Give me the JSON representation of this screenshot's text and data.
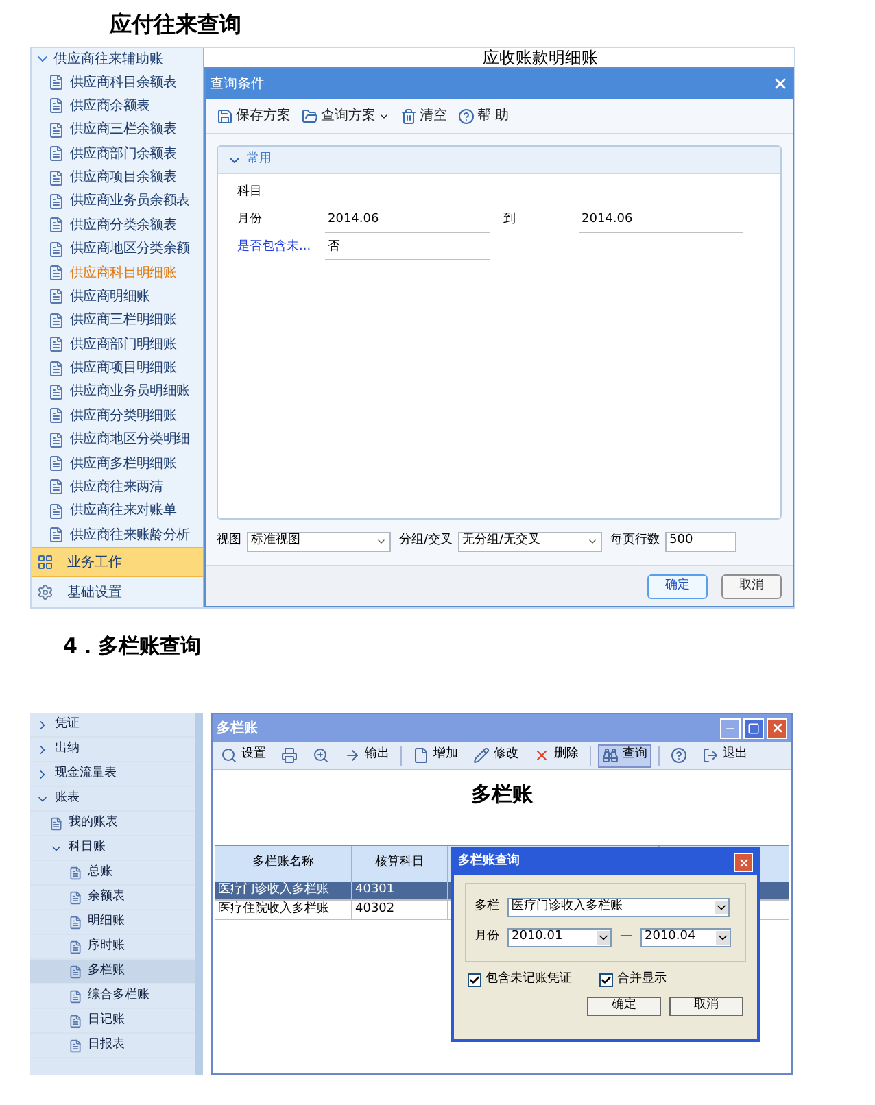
{
  "section1": {
    "heading": "应付往来查询",
    "sidebar": {
      "group": {
        "label": "供应商往来辅助账",
        "expanded": true
      },
      "items": [
        {
          "label": "供应商科目余额表",
          "selected": false
        },
        {
          "label": "供应商余额表",
          "selected": false
        },
        {
          "label": "供应商三栏余额表",
          "selected": false
        },
        {
          "label": "供应商部门余额表",
          "selected": false
        },
        {
          "label": "供应商项目余额表",
          "selected": false
        },
        {
          "label": "供应商业务员余额表",
          "selected": false
        },
        {
          "label": "供应商分类余额表",
          "selected": false
        },
        {
          "label": "供应商地区分类余额",
          "selected": false
        },
        {
          "label": "供应商科目明细账",
          "selected": true
        },
        {
          "label": "供应商明细账",
          "selected": false
        },
        {
          "label": "供应商三栏明细账",
          "selected": false
        },
        {
          "label": "供应商部门明细账",
          "selected": false
        },
        {
          "label": "供应商项目明细账",
          "selected": false
        },
        {
          "label": "供应商业务员明细账",
          "selected": false
        },
        {
          "label": "供应商分类明细账",
          "selected": false
        },
        {
          "label": "供应商地区分类明细",
          "selected": false
        },
        {
          "label": "供应商多栏明细账",
          "selected": false
        },
        {
          "label": "供应商往来两清",
          "selected": false
        },
        {
          "label": "供应商往来对账单",
          "selected": false
        },
        {
          "label": "供应商往来账龄分析",
          "selected": false
        }
      ],
      "nav": [
        {
          "label": "业务工作",
          "selected": true,
          "kind": "work"
        },
        {
          "label": "基础设置",
          "selected": false,
          "kind": "settings"
        }
      ]
    },
    "background_title": "应收账款明细账",
    "dialog": {
      "title": "查询条件",
      "toolbar": [
        {
          "label": "保存方案",
          "kind": "save",
          "dropdown": false
        },
        {
          "label": "查询方案",
          "kind": "folder",
          "dropdown": true
        },
        {
          "label": "清空",
          "kind": "clear",
          "dropdown": false
        },
        {
          "label": "帮 助",
          "kind": "help",
          "dropdown": false
        }
      ],
      "group": {
        "label": "常用",
        "expanded": true
      },
      "fields": [
        {
          "label": "科目",
          "link": false
        },
        {
          "label": "月份",
          "value": "2014.06",
          "link": false,
          "to_label": "到",
          "to_value": "2014.06"
        },
        {
          "label": "是否包含未...",
          "value": "否",
          "link": true
        }
      ],
      "options": [
        {
          "label": "视图",
          "value": "标准视图",
          "kind": "select"
        },
        {
          "label": "分组/交叉",
          "value": "无分组/无交叉",
          "kind": "select"
        },
        {
          "label": "每页行数",
          "value": "500",
          "kind": "input"
        }
      ],
      "buttons": [
        {
          "label": "确定",
          "primary": true
        },
        {
          "label": "取消",
          "primary": false
        }
      ]
    }
  },
  "section2": {
    "heading": "4．多栏账查询",
    "tree": [
      {
        "label": "凭证",
        "expanded": false
      },
      {
        "label": "出纳",
        "expanded": false
      },
      {
        "label": "现金流量表",
        "expanded": false
      },
      {
        "label": "账表",
        "expanded": true,
        "children": [
          {
            "label": "我的账表"
          },
          {
            "label": "科目账",
            "expanded": true,
            "children": [
              {
                "label": "总账",
                "selected": false
              },
              {
                "label": "余额表",
                "selected": false
              },
              {
                "label": "明细账",
                "selected": false
              },
              {
                "label": "序时账",
                "selected": false
              },
              {
                "label": "多栏账",
                "selected": true
              },
              {
                "label": "综合多栏账",
                "selected": false
              },
              {
                "label": "日记账",
                "selected": false
              },
              {
                "label": "日报表",
                "selected": false
              }
            ]
          }
        ]
      }
    ],
    "window": {
      "title": "多栏账",
      "toolbar": [
        {
          "kind": "preview",
          "label": "设置",
          "active": false
        },
        {
          "kind": "print",
          "active": false
        },
        {
          "kind": "zoom",
          "active": false
        },
        {
          "kind": "export",
          "label": "输出",
          "active": false
        },
        {
          "kind": "sep"
        },
        {
          "kind": "new",
          "label": "增加",
          "active": false
        },
        {
          "kind": "edit",
          "label": "修改",
          "active": false
        },
        {
          "kind": "delete",
          "label": "删除",
          "active": false
        },
        {
          "kind": "sep"
        },
        {
          "kind": "find",
          "label": "查询",
          "active": true
        },
        {
          "kind": "sep"
        },
        {
          "kind": "help",
          "active": false
        },
        {
          "kind": "exit",
          "label": "退出",
          "active": false
        }
      ],
      "heading": "多栏账",
      "table": {
        "columns": [
          "多栏账名称",
          "核算科目"
        ],
        "rows": [
          {
            "cells": [
              "医疗门诊收入多栏账",
              "40301"
            ],
            "selected": true
          },
          {
            "cells": [
              "医疗住院收入多栏账",
              "40302"
            ],
            "selected": false
          }
        ]
      }
    },
    "dialog": {
      "title": "多栏账查询",
      "column_label": "多栏",
      "column_value": "医疗门诊收入多栏账",
      "month_label": "月份",
      "month_from": "2010.01",
      "month_sep": "—",
      "month_to": "2010.04",
      "checks": [
        {
          "label": "包含未记账凭证",
          "checked": true
        },
        {
          "label": "合并显示",
          "checked": true
        }
      ],
      "buttons": [
        "确定",
        "取消"
      ]
    }
  }
}
